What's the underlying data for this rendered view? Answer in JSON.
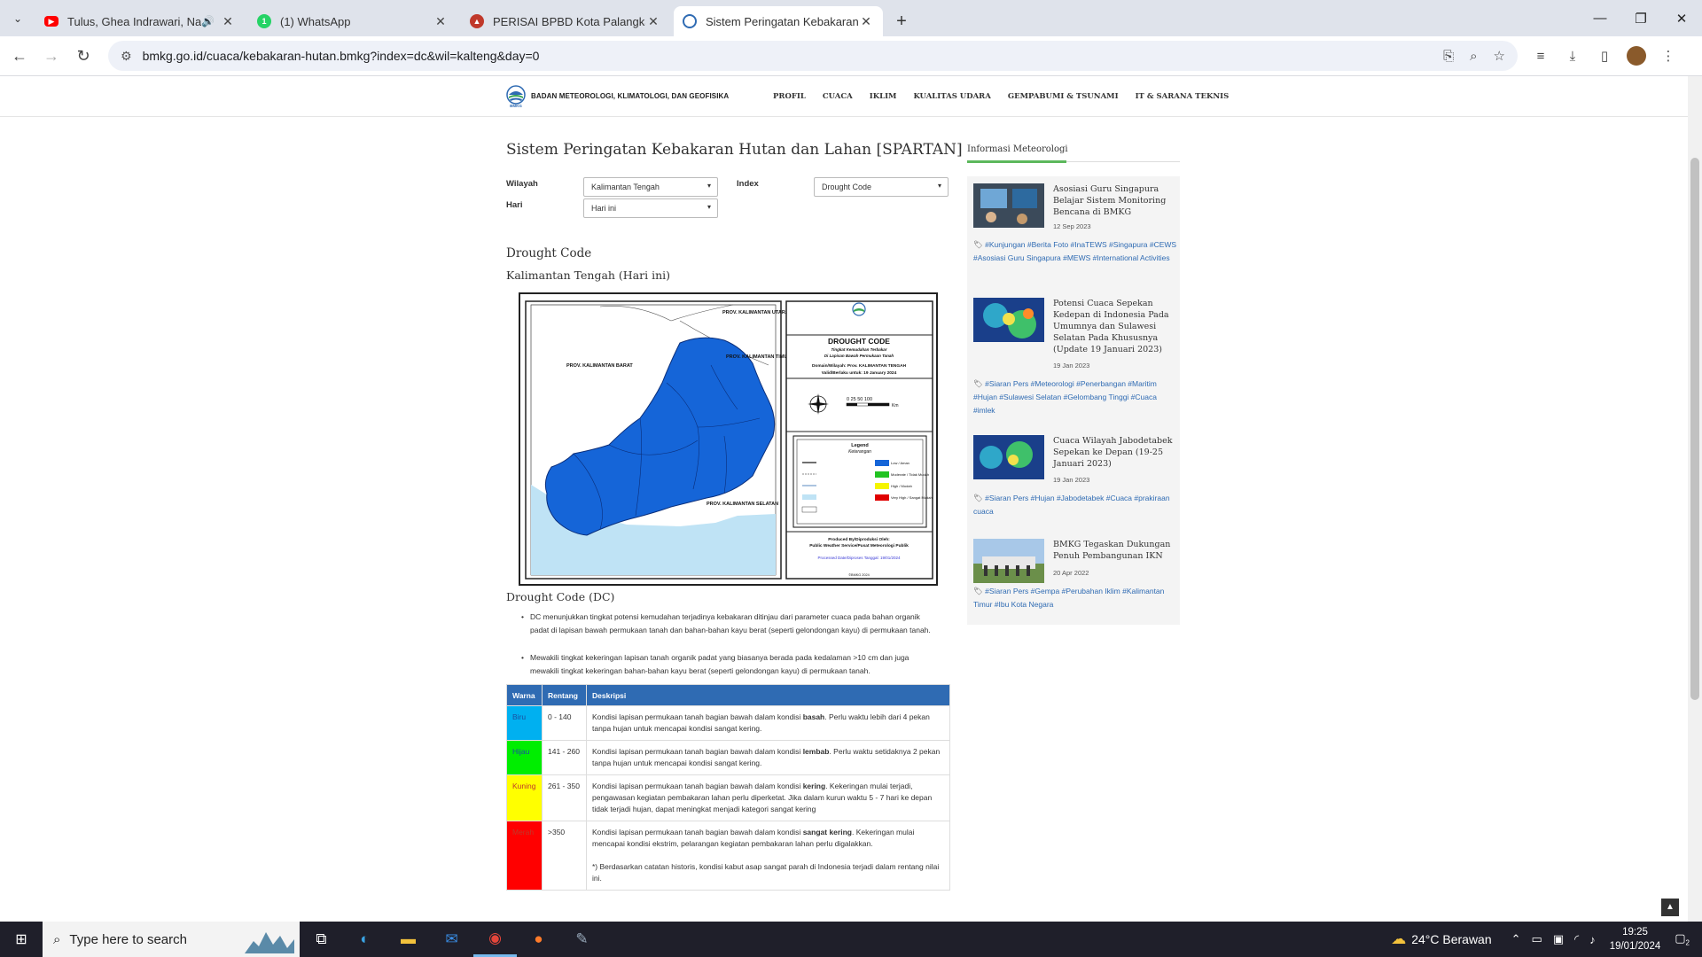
{
  "browser": {
    "tabs": [
      {
        "title": "Tulus, Ghea Indrawari, Nadi",
        "icon": "youtube-icon",
        "color": "#ff0000"
      },
      {
        "title": "(1) WhatsApp",
        "icon": "whatsapp-icon",
        "color": "#25d366"
      },
      {
        "title": "PERISAI BPBD Kota Palangka Ra",
        "icon": "perisai-icon",
        "color": "#c0392b"
      },
      {
        "title": "Sistem Peringatan Kebakaran H",
        "icon": "bmkg-icon",
        "color": "#2f6bb3"
      }
    ],
    "url": "bmkg.go.id/cuaca/kebakaran-hutan.bmkg?index=dc&wil=kalteng&day=0"
  },
  "header": {
    "brand": "BADAN METEOROLOGI, KLIMATOLOGI, DAN GEOFISIKA",
    "logo_text": "BMKG",
    "menu": [
      "PROFIL",
      "CUACA",
      "IKLIM",
      "KUALITAS UDARA",
      "GEMPABUMI & TSUNAMI",
      "IT & SARANA TEKNIS"
    ]
  },
  "main": {
    "title": "Sistem Peringatan Kebakaran Hutan dan Lahan [SPARTAN]",
    "form": {
      "wilayah_label": "Wilayah",
      "wilayah_value": "Kalimantan Tengah",
      "index_label": "Index",
      "index_value": "Drought Code",
      "hari_label": "Hari",
      "hari_value": "Hari ini"
    },
    "section_title": "Drought Code",
    "region_title": "Kalimantan Tengah (Hari ini)",
    "map": {
      "title": "DROUGHT CODE",
      "subtitle1": "Tingkat Kemudahan Terbakar",
      "subtitle2": "Di Lapisan Bawah Permukaan Tanah",
      "domain": "Domain/Wilayah: Prov. KALIMANTAN TENGAH",
      "valid": "Valid/Berlaku untuk: 19 January 2024",
      "scale": "0  25 50       100",
      "scale_unit": "Km",
      "legend_title": "Legend",
      "legend_sub": "Keterangan",
      "legend_items": [
        "Low / Aman",
        "Moderate / Tidak Mudah",
        "High / Mudah",
        "Very High / Sangat Mudah"
      ],
      "legend_colors": [
        "#1565d8",
        "#22c322",
        "#f5f500",
        "#e00000"
      ],
      "produced": "Produced By/Diproduksi Oleh:",
      "producer": "Public Weather Service/Pusat Meteorologi Publik",
      "processed": "Processed Date/Diproses Tanggal: 19/01/2024",
      "copyright": "©BMKG 2024",
      "labels": {
        "barat": "PROV. KALIMANTAN BARAT",
        "utara": "PROV. KALIMANTAN UTARA",
        "timur": "PROV. KALIMANTAN TIMUR",
        "selatan": "PROV. KALIMANTAN SELATAN"
      }
    },
    "dc_title": "Drought Code (DC)",
    "bullets": [
      "DC menunjukkan tingkat potensi kemudahan terjadinya kebakaran ditinjau dari parameter cuaca pada bahan organik padat di lapisan bawah permukaan tanah dan bahan-bahan kayu berat (seperti gelondongan kayu) di permukaan tanah.",
      "Mewakili tingkat kekeringan lapisan tanah organik padat yang biasanya berada pada kedalaman >10 cm dan juga mewakili tingkat kekeringan bahan-bahan kayu berat (seperti gelondongan kayu) di permukaan tanah."
    ],
    "table": {
      "headers": [
        "Warna",
        "Rentang",
        "Deskripsi"
      ],
      "rows": [
        {
          "warna": "Biru",
          "color": "#00b0f0",
          "text_color": "#1a4fa0",
          "rentang": "0 - 140",
          "pre": "Kondisi lapisan permukaan tanah bagian bawah dalam kondisi ",
          "bold": "basah",
          "post": ". Perlu waktu lebih dari 4 pekan tanpa hujan untuk mencapai kondisi sangat kering.",
          "note": ""
        },
        {
          "warna": "Hijau",
          "color": "#00ee00",
          "text_color": "#1a4fa0",
          "rentang": "141 - 260",
          "pre": "Kondisi lapisan permukaan tanah bagian bawah dalam kondisi ",
          "bold": "lembab",
          "post": ". Perlu waktu setidaknya 2 pekan tanpa hujan untuk mencapai kondisi sangat kering.",
          "note": ""
        },
        {
          "warna": "Kuning",
          "color": "#ffff00",
          "text_color": "#c0392b",
          "rentang": "261 - 350",
          "pre": "Kondisi lapisan permukaan tanah bagian bawah dalam kondisi ",
          "bold": "kering",
          "post": ". Kekeringan mulai terjadi, pengawasan kegiatan pembakaran lahan perlu diperketat. Jika dalam kurun waktu 5 - 7 hari ke depan tidak terjadi hujan, dapat meningkat menjadi kategori sangat kering",
          "note": ""
        },
        {
          "warna": "Merah",
          "color": "#ff0000",
          "text_color": "#c0392b",
          "rentang": ">350",
          "pre": "Kondisi lapisan permukaan tanah bagian bawah dalam kondisi ",
          "bold": "sangat kering",
          "post": ". Kekeringan mulai mencapai kondisi ekstrim, pelarangan kegiatan pembakaran lahan perlu digalakkan.",
          "note": "*) Berdasarkan catatan historis, kondisi kabut asap sangat parah di Indonesia terjadi dalam rentang nilai ini."
        }
      ]
    }
  },
  "sidebar": {
    "title": "Informasi Meteorologi",
    "news": [
      {
        "title": "Asosiasi Guru Singapura Belajar Sistem Monitoring Bencana di BMKG",
        "date": "12 Sep 2023",
        "tags": "#Kunjungan #Berita Foto #InaTEWS #Singapura #CEWS #Asosiasi Guru Singapura #MEWS #International Activities"
      },
      {
        "title": "Potensi Cuaca Sepekan Kedepan di Indonesia Pada Umumnya dan Sulawesi Selatan Pada Khususnya (Update 19 Januari 2023)",
        "date": "19 Jan 2023",
        "tags": "#Siaran Pers #Meteorologi #Penerbangan #Maritim #Hujan #Sulawesi Selatan #Gelombang Tinggi #Cuaca #imlek"
      },
      {
        "title": "Cuaca Wilayah Jabodetabek Sepekan ke Depan (19-25 Januari 2023)",
        "date": "19 Jan 2023",
        "tags": "#Siaran Pers #Hujan #Jabodetabek #Cuaca #prakiraan cuaca"
      },
      {
        "title": "BMKG Tegaskan Dukungan Penuh Pembangunan IKN",
        "date": "20 Apr 2022",
        "tags": "#Siaran Pers #Gempa #Perubahan Iklim #Kalimantan Timur #Ibu Kota Negara"
      }
    ]
  },
  "taskbar": {
    "search_placeholder": "Type here to search",
    "weather": "24°C  Berawan",
    "time": "19:25",
    "date": "19/01/2024",
    "notif_count": "2"
  }
}
